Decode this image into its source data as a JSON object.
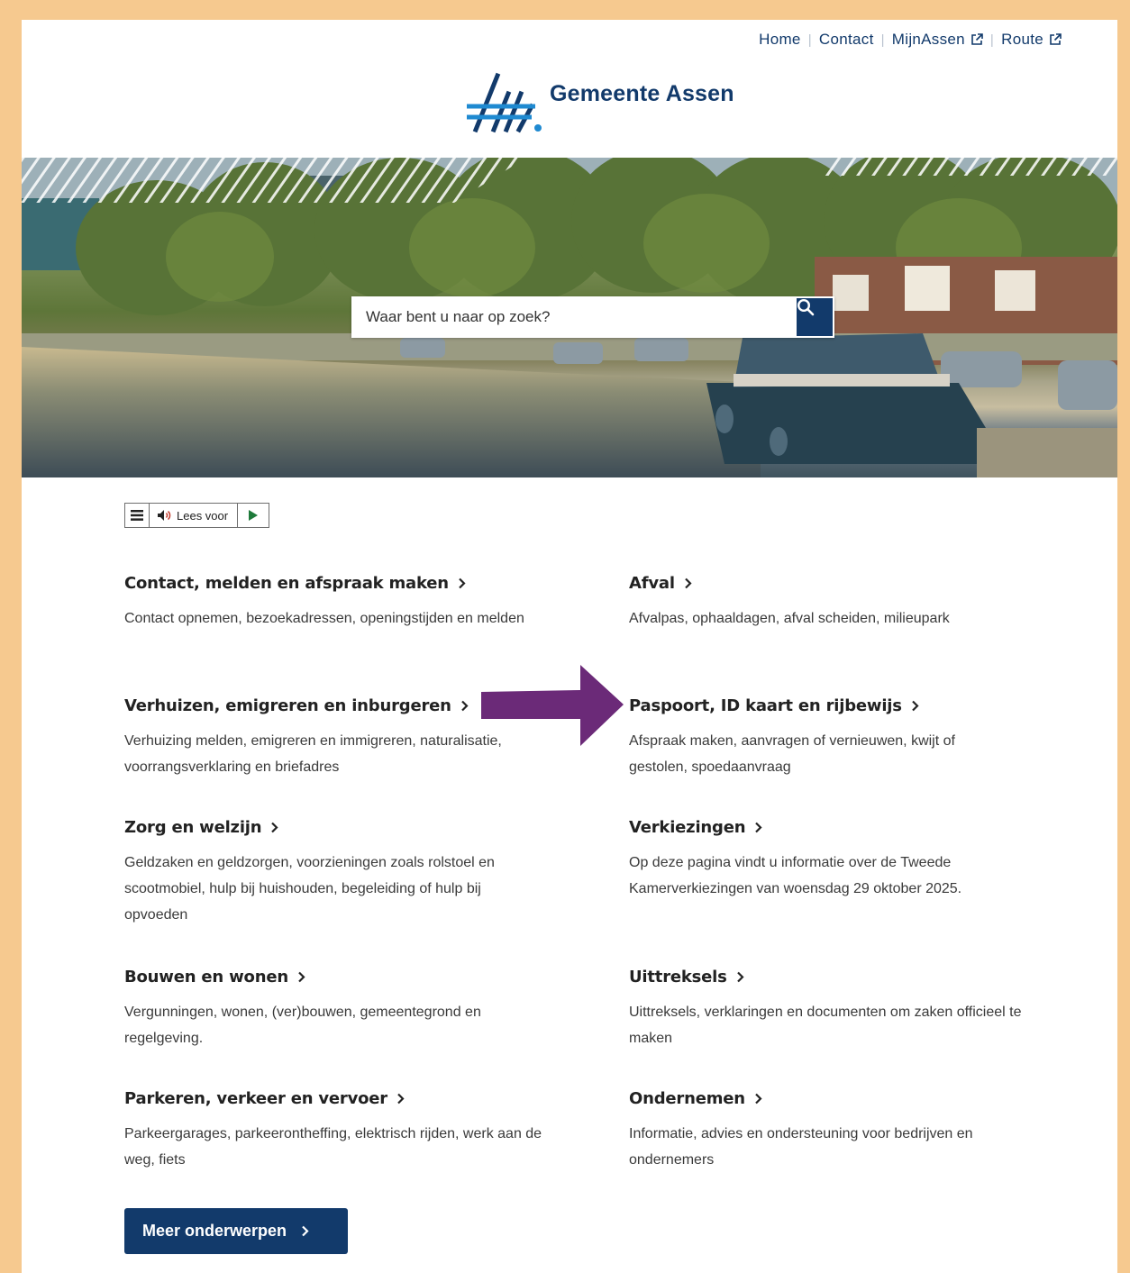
{
  "nav": {
    "home": "Home",
    "contact": "Contact",
    "mijnassen": "MijnAssen",
    "route": "Route"
  },
  "logo": {
    "text": "Gemeente Assen"
  },
  "search": {
    "placeholder": "Waar bent u naar op zoek?"
  },
  "readspeaker": {
    "label": "Lees voor"
  },
  "topics": [
    {
      "title": "Contact, melden en afspraak maken",
      "description": "Contact opnemen, bezoekadressen, openingstijden en melden"
    },
    {
      "title": "Afval",
      "description": "Afvalpas, ophaaldagen, afval scheiden, milieupark"
    },
    {
      "title": "Verhuizen, emigreren en inburgeren",
      "description": "Verhuizing melden, emigreren en immigreren, naturalisatie, voorrangsverklaring en briefadres"
    },
    {
      "title": "Paspoort, ID kaart en rijbewijs",
      "description": "Afspraak maken, aanvragen of vernieuwen, kwijt of gestolen, spoedaanvraag"
    },
    {
      "title": "Zorg en welzijn",
      "description": "Geldzaken en geldzorgen, voorzieningen zoals rolstoel en scootmobiel, hulp bij huishouden, begeleiding of hulp bij opvoeden"
    },
    {
      "title": "Verkiezingen",
      "description": "Op deze pagina vindt u informatie over de Tweede Kamerverkiezingen van woensdag 29 oktober 2025."
    },
    {
      "title": "Bouwen en wonen",
      "description": "Vergunningen, wonen, (ver)bouwen, gemeentegrond en regelgeving."
    },
    {
      "title": "Uittreksels",
      "description": "Uittreksels, verklaringen en documenten om zaken officieel te maken"
    },
    {
      "title": "Parkeren, verkeer en vervoer",
      "description": "Parkeergarages, parkeerontheffing, elektrisch rijden, werk aan de weg, fiets"
    },
    {
      "title": "Ondernemen",
      "description": "Informatie, advies en ondersteuning voor bedrijven en ondernemers"
    }
  ],
  "more_button": {
    "label": "Meer onderwerpen"
  },
  "colors": {
    "brand": "#123a6b",
    "accent": "#1f8ad1",
    "annotation_arrow": "#6b2a78",
    "frame": "#f6c98f"
  }
}
